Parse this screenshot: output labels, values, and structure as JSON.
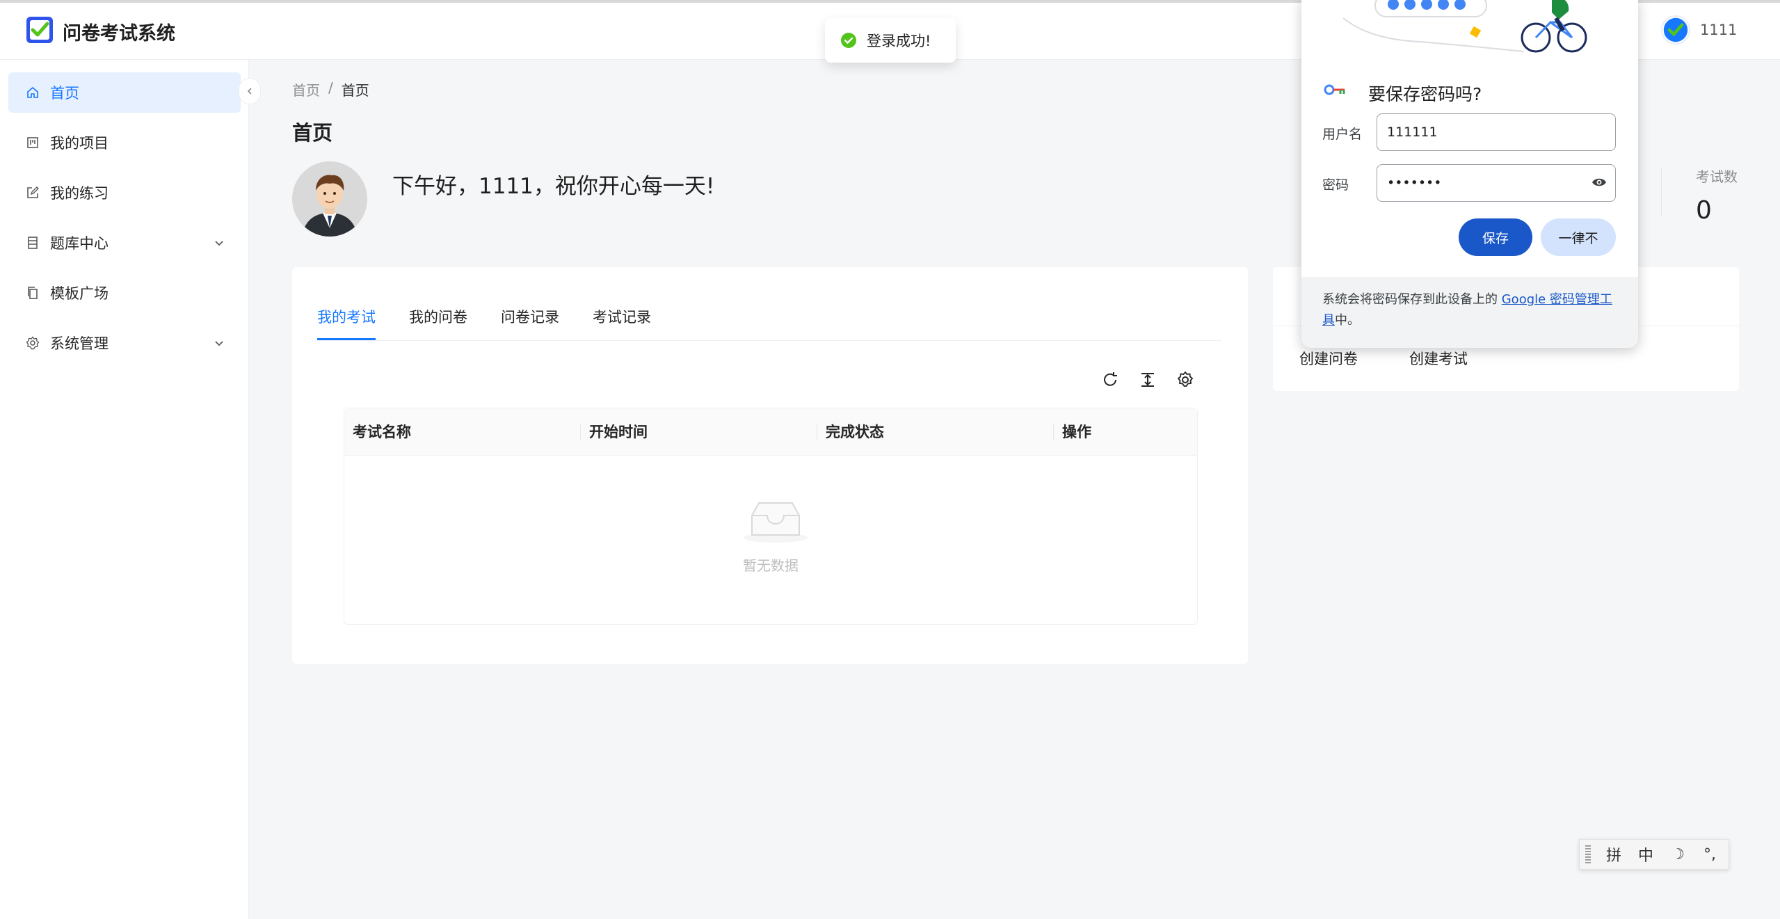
{
  "app": {
    "title": "问卷考试系统"
  },
  "user": {
    "name": "1111"
  },
  "sidebar": {
    "items": [
      {
        "label": "首页",
        "icon": "home-icon",
        "active": true
      },
      {
        "label": "我的项目",
        "icon": "project-icon"
      },
      {
        "label": "我的练习",
        "icon": "edit-icon"
      },
      {
        "label": "题库中心",
        "icon": "database-icon",
        "expandable": true
      },
      {
        "label": "模板广场",
        "icon": "copy-icon"
      },
      {
        "label": "系统管理",
        "icon": "gear-icon",
        "expandable": true
      }
    ]
  },
  "breadcrumb": {
    "root": "首页",
    "separator": "/",
    "current": "首页"
  },
  "page": {
    "title": "首页",
    "greeting": "下午好，1111，祝你开心每一天!",
    "stat": {
      "label": "考试数",
      "value": "0"
    }
  },
  "main_card": {
    "tabs": [
      {
        "label": "我的考试",
        "active": true
      },
      {
        "label": "我的问卷"
      },
      {
        "label": "问卷记录"
      },
      {
        "label": "考试记录"
      }
    ],
    "toolbar_icons": [
      "reload-icon",
      "column-height-icon",
      "setting-icon"
    ],
    "table": {
      "columns": [
        "考试名称",
        "开始时间",
        "完成状态",
        "操作"
      ],
      "rows": [],
      "empty_text": "暂无数据"
    }
  },
  "quick_actions": {
    "items": [
      "创建问卷",
      "创建考试"
    ]
  },
  "toast": {
    "text": "登录成功!",
    "icon": "check-circle-icon"
  },
  "password_prompt": {
    "title": "要保存密码吗?",
    "username_label": "用户名",
    "username_value": "111111",
    "password_label": "密码",
    "password_value": "•••••••",
    "save_label": "保存",
    "never_label": "一律不",
    "footer_text": "系统会将密码保存到此设备上的",
    "footer_link": "Google 密码管理工具",
    "footer_suffix": "中。"
  },
  "ime": {
    "items": [
      "拼",
      "中",
      "☽",
      "°,"
    ]
  },
  "colors": {
    "primary": "#1677ff",
    "success": "#52c41a",
    "chrome_blue": "#1a57c8",
    "chrome_light_blue": "#d3e3fd"
  }
}
